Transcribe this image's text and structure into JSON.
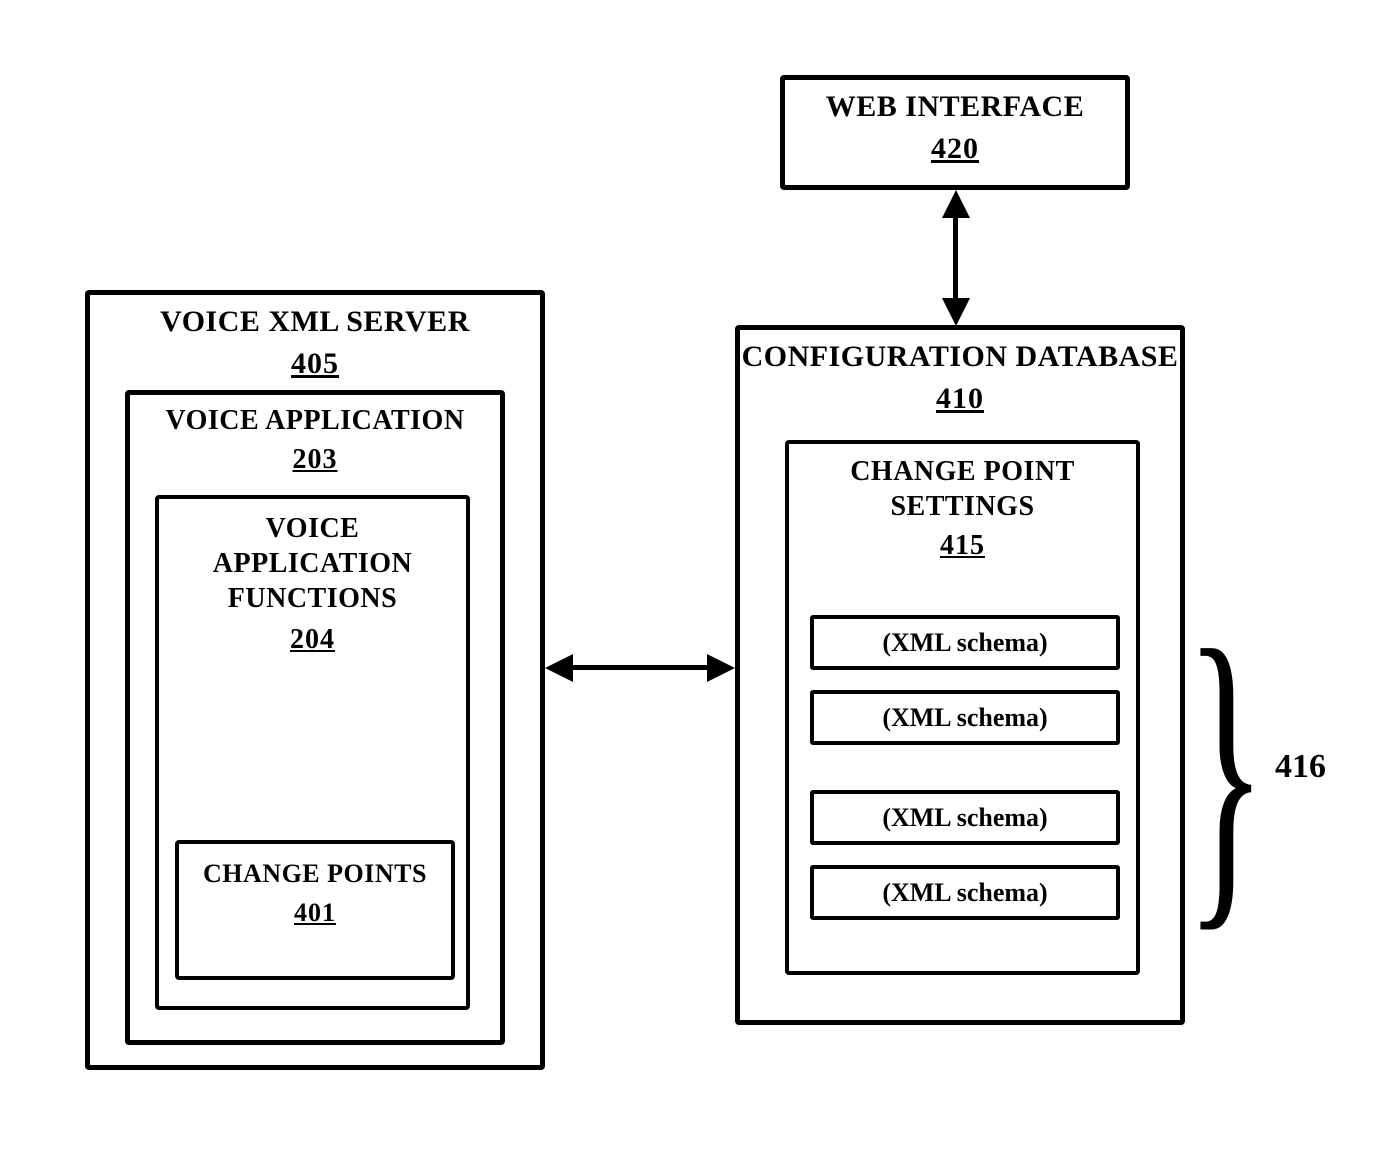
{
  "web_interface": {
    "title": "WEB INTERFACE",
    "ref": "420"
  },
  "voice_xml_server": {
    "title": "VOICE XML SERVER",
    "ref": "405"
  },
  "voice_application": {
    "title": "VOICE APPLICATION",
    "ref": "203"
  },
  "voice_app_functions": {
    "title_l1": "VOICE",
    "title_l2": "APPLICATION",
    "title_l3": "FUNCTIONS",
    "ref": "204"
  },
  "change_points": {
    "title": "CHANGE POINTS",
    "ref": "401"
  },
  "config_db": {
    "title": "CONFIGURATION DATABASE",
    "ref": "410"
  },
  "change_point_settings": {
    "title_l1": "CHANGE POINT",
    "title_l2": "SETTINGS",
    "ref": "415"
  },
  "schemas": [
    "(XML schema)",
    "(XML schema)",
    "(XML schema)",
    "(XML schema)"
  ],
  "schema_group_ref": "416"
}
